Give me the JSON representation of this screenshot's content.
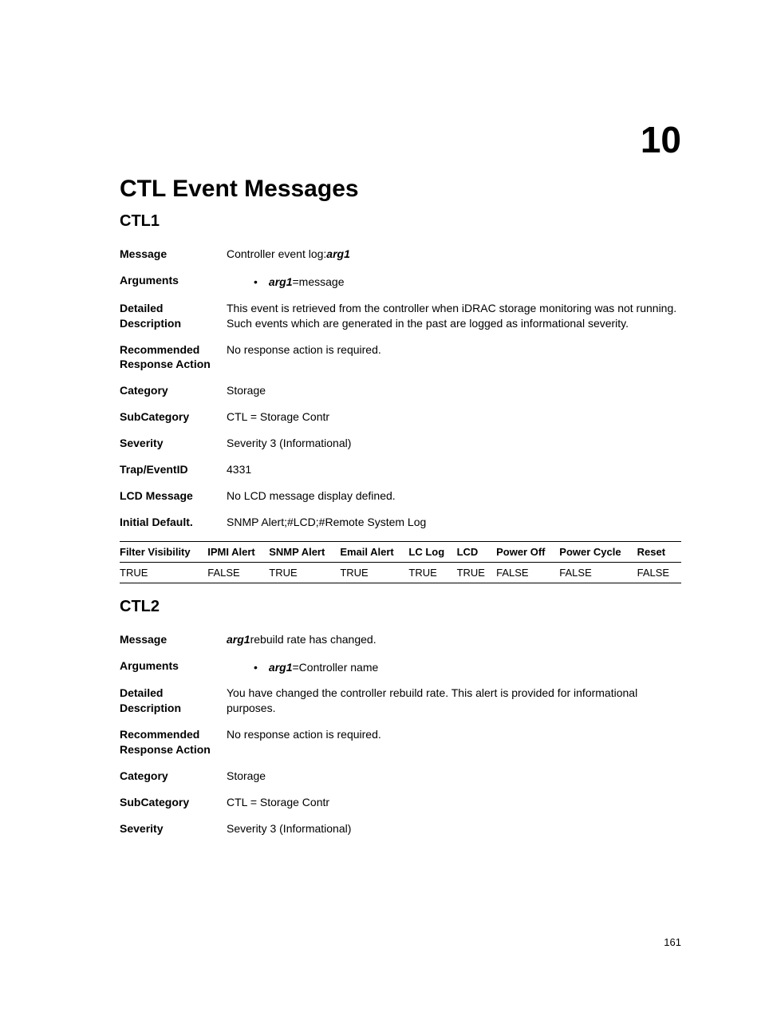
{
  "chapter_number": "10",
  "chapter_title": "CTL Event Messages",
  "page_number": "161",
  "sections": [
    {
      "id": "CTL1",
      "message_prefix": "Controller event log:",
      "message_arg": "arg1",
      "message_suffix": "",
      "arguments": [
        {
          "name": "arg1",
          "desc": "message"
        }
      ],
      "detailed_description": "This event is retrieved from the controller when iDRAC storage monitoring was not running. Such events which are generated in the past are logged as informational severity.",
      "recommended_response_action": "No response action is required.",
      "category": "Storage",
      "subcategory": "CTL = Storage Contr",
      "severity": "Severity 3 (Informational)",
      "trap_event_id": "4331",
      "lcd_message": "No LCD message display defined.",
      "initial_default": "SNMP Alert;#LCD;#Remote System Log",
      "chart_data": {
        "type": "table",
        "headers": [
          "Filter Visibility",
          "IPMI Alert",
          "SNMP Alert",
          "Email Alert",
          "LC Log",
          "LCD",
          "Power Off",
          "Power Cycle",
          "Reset"
        ],
        "rows": [
          [
            "TRUE",
            "FALSE",
            "TRUE",
            "TRUE",
            "TRUE",
            "TRUE",
            "FALSE",
            "FALSE",
            "FALSE"
          ]
        ]
      }
    },
    {
      "id": "CTL2",
      "message_prefix": "",
      "message_arg": "arg1",
      "message_suffix": "rebuild rate has changed.",
      "arguments": [
        {
          "name": "arg1",
          "desc": "Controller name"
        }
      ],
      "detailed_description": "You have changed the controller rebuild rate. This alert is provided for informational purposes.",
      "recommended_response_action": "No response action is required.",
      "category": "Storage",
      "subcategory": "CTL = Storage Contr",
      "severity": "Severity 3 (Informational)"
    }
  ],
  "labels": {
    "message": "Message",
    "arguments": "Arguments",
    "detailed_description": "Detailed Description",
    "recommended_response_action": "Recommended Response Action",
    "category": "Category",
    "subcategory": "SubCategory",
    "severity": "Severity",
    "trap_event_id": "Trap/EventID",
    "lcd_message": "LCD Message",
    "initial_default": "Initial Default.",
    "eq": " = "
  }
}
